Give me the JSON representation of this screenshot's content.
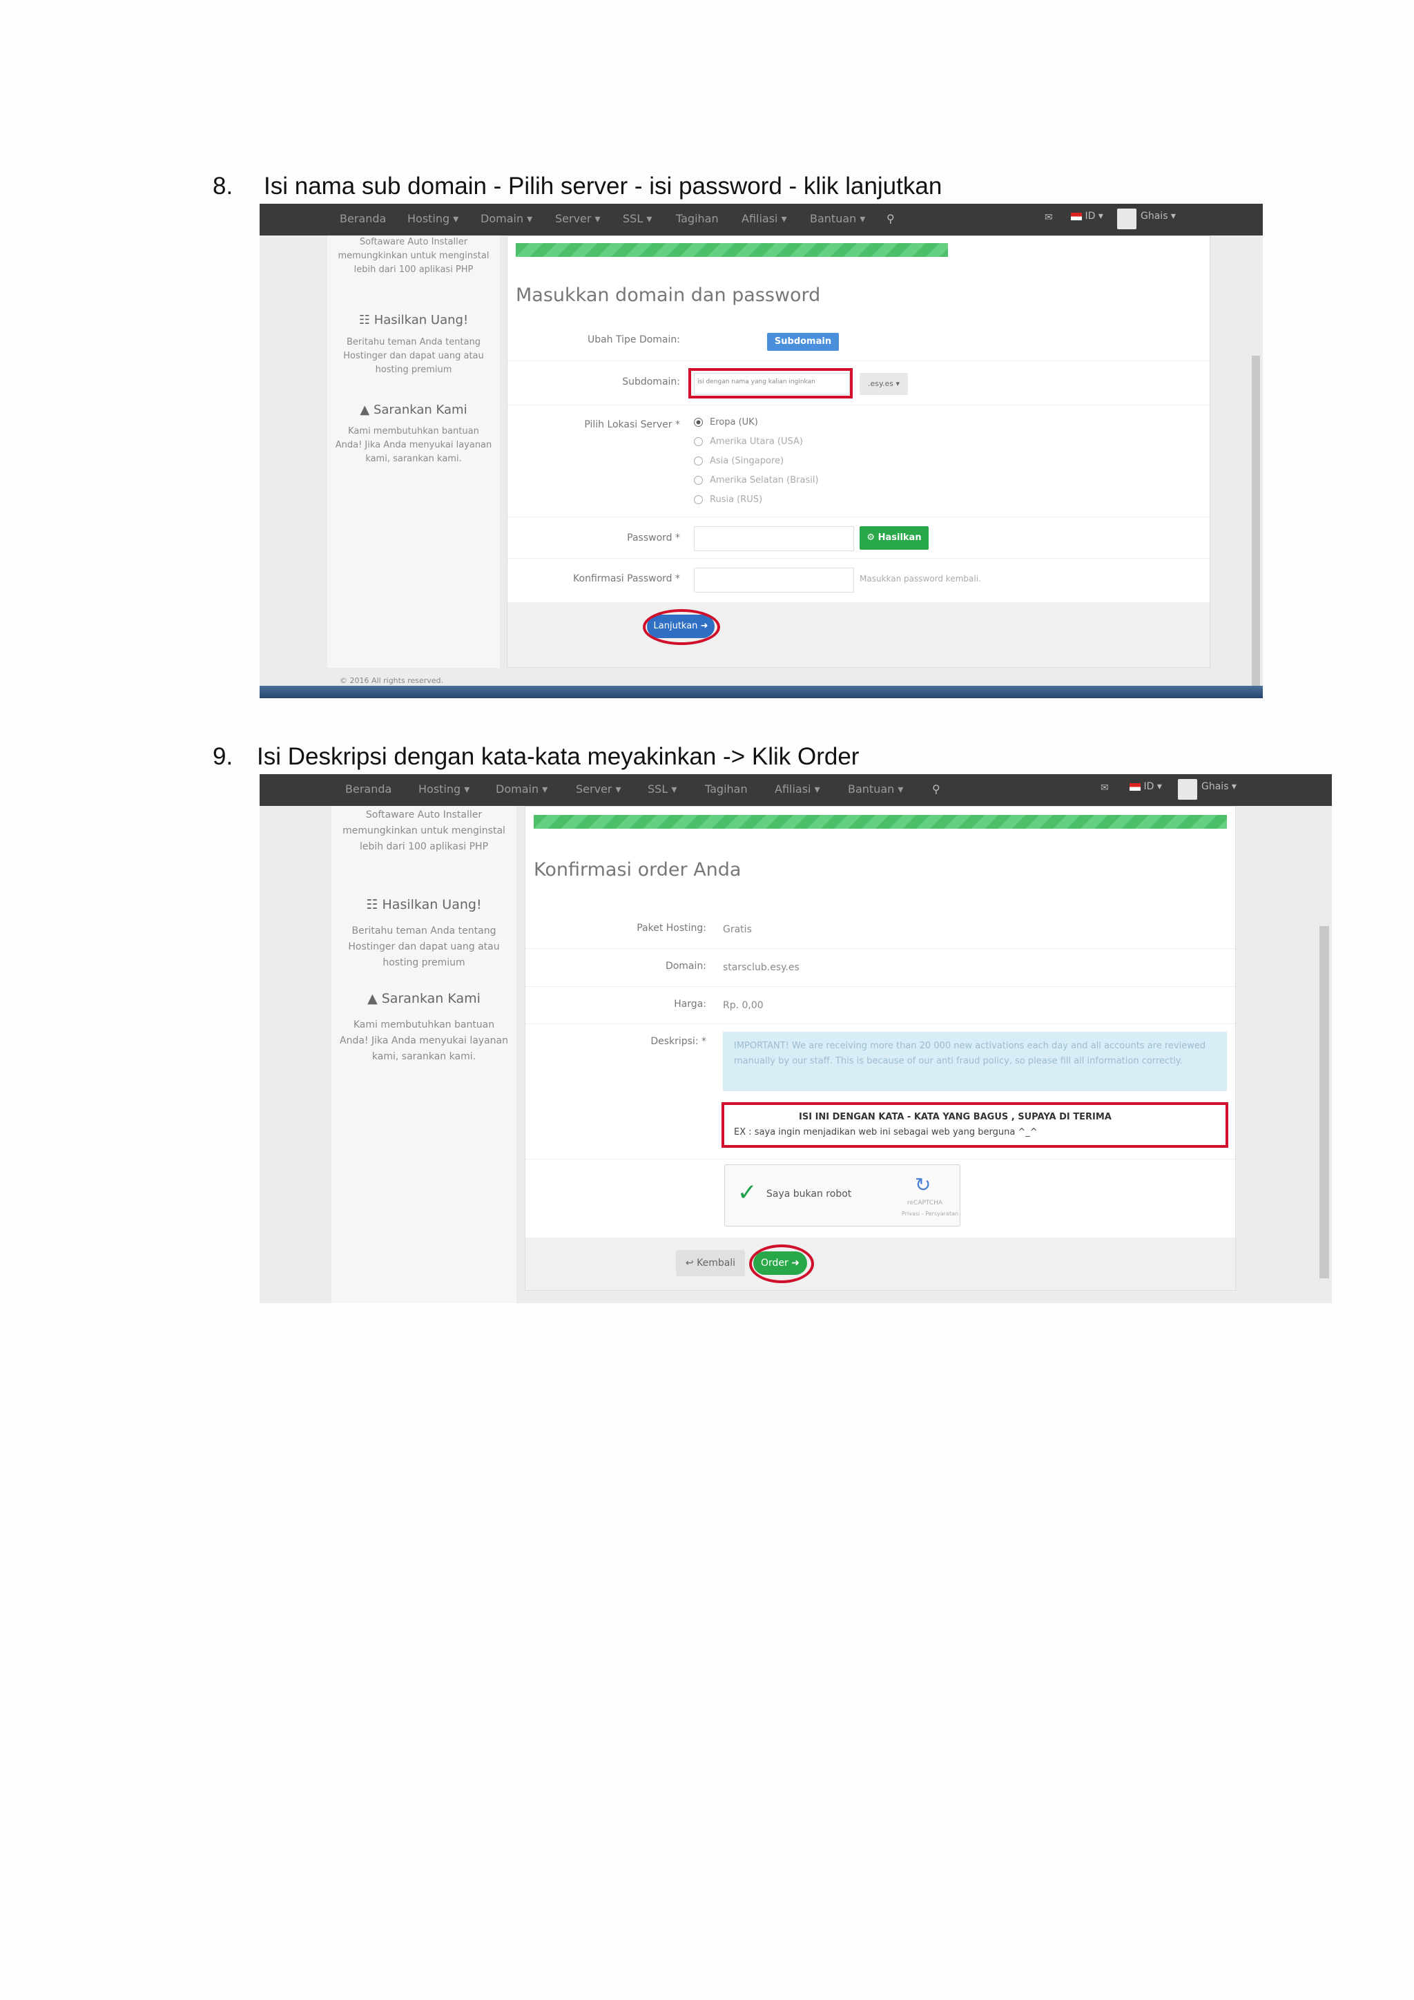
{
  "step8": {
    "number": "8.",
    "title": "Isi nama sub domain - Pilih server - isi password - klik lanjutkan"
  },
  "step9": {
    "number": "9.",
    "title": "Isi Deskripsi dengan kata-kata meyakinkan -> Klik Order"
  },
  "nav": {
    "items": [
      "Beranda",
      "Hosting ▾",
      "Domain ▾",
      "Server ▾",
      "SSL ▾",
      "Tagihan",
      "Afiliasi ▾",
      "Bantuan ▾"
    ],
    "lang": "ID ▾",
    "user": "Ghais ▾"
  },
  "sidebar": {
    "installer_text": "Softaware Auto Installer memungkinkan untuk menginstal lebih dari 100 aplikasi PHP",
    "earn_heading": "Hasilkan Uang!",
    "earn_text": "Beritahu teman Anda tentang Hostinger dan dapat uang atau hosting premium",
    "suggest_heading": "Sarankan Kami",
    "suggest_text": "Kami membutuhkan bantuan Anda! Jika Anda menyukai layanan kami, sarankan kami."
  },
  "form1": {
    "title": "Masukkan domain dan password",
    "domain_type_label": "Ubah Tipe Domain:",
    "domain_type_button": "Subdomain",
    "subdomain_label": "Subdomain:",
    "subdomain_placeholder": "isi dengan nama yang kalian inginkan",
    "subdomain_suffix": ".esy.es ▾",
    "server_label": "Pilih Lokasi Server *",
    "server_options": [
      "Eropa (UK)",
      "Amerika Utara (USA)",
      "Asia (Singapore)",
      "Amerika Selatan (Brasil)",
      "Rusia (RUS)"
    ],
    "password_label": "Password *",
    "generate_button": "Hasilkan",
    "confirm_label": "Konfirmasi Password *",
    "confirm_hint": "Masukkan password kembali.",
    "continue_button": "Lanjutkan",
    "copyright": "© 2016 All rights reserved."
  },
  "form2": {
    "title": "Konfirmasi order Anda",
    "package_label": "Paket Hosting:",
    "package_value": "Gratis",
    "domain_label": "Domain:",
    "domain_value": "starsclub.esy.es",
    "price_label": "Harga:",
    "price_value": "Rp. 0,00",
    "description_label": "Deskripsi: *",
    "notice": "IMPORTANT! We are receiving more than 20 000 new activations each day and all accounts are reviewed manually by our staff. This is because of our anti fraud policy, so please fill all information correctly.",
    "description_line1": "ISI INI DENGAN KATA - KATA YANG BAGUS , SUPAYA DI TERIMA",
    "description_line2": "EX : saya ingin menjadikan web ini sebagai web yang berguna ^_^",
    "captcha_label": "Saya bukan robot",
    "captcha_brand": "reCAPTCHA",
    "captcha_links": "Privasi - Persyaratan",
    "back_button": "Kembali",
    "order_button": "Order"
  },
  "colors": {
    "navbar": "#3a3a3a",
    "progress": "#4cbf6a",
    "primary_button": "#4a8fdb",
    "success_button": "#29a84a",
    "annotation": "#d0102a"
  }
}
